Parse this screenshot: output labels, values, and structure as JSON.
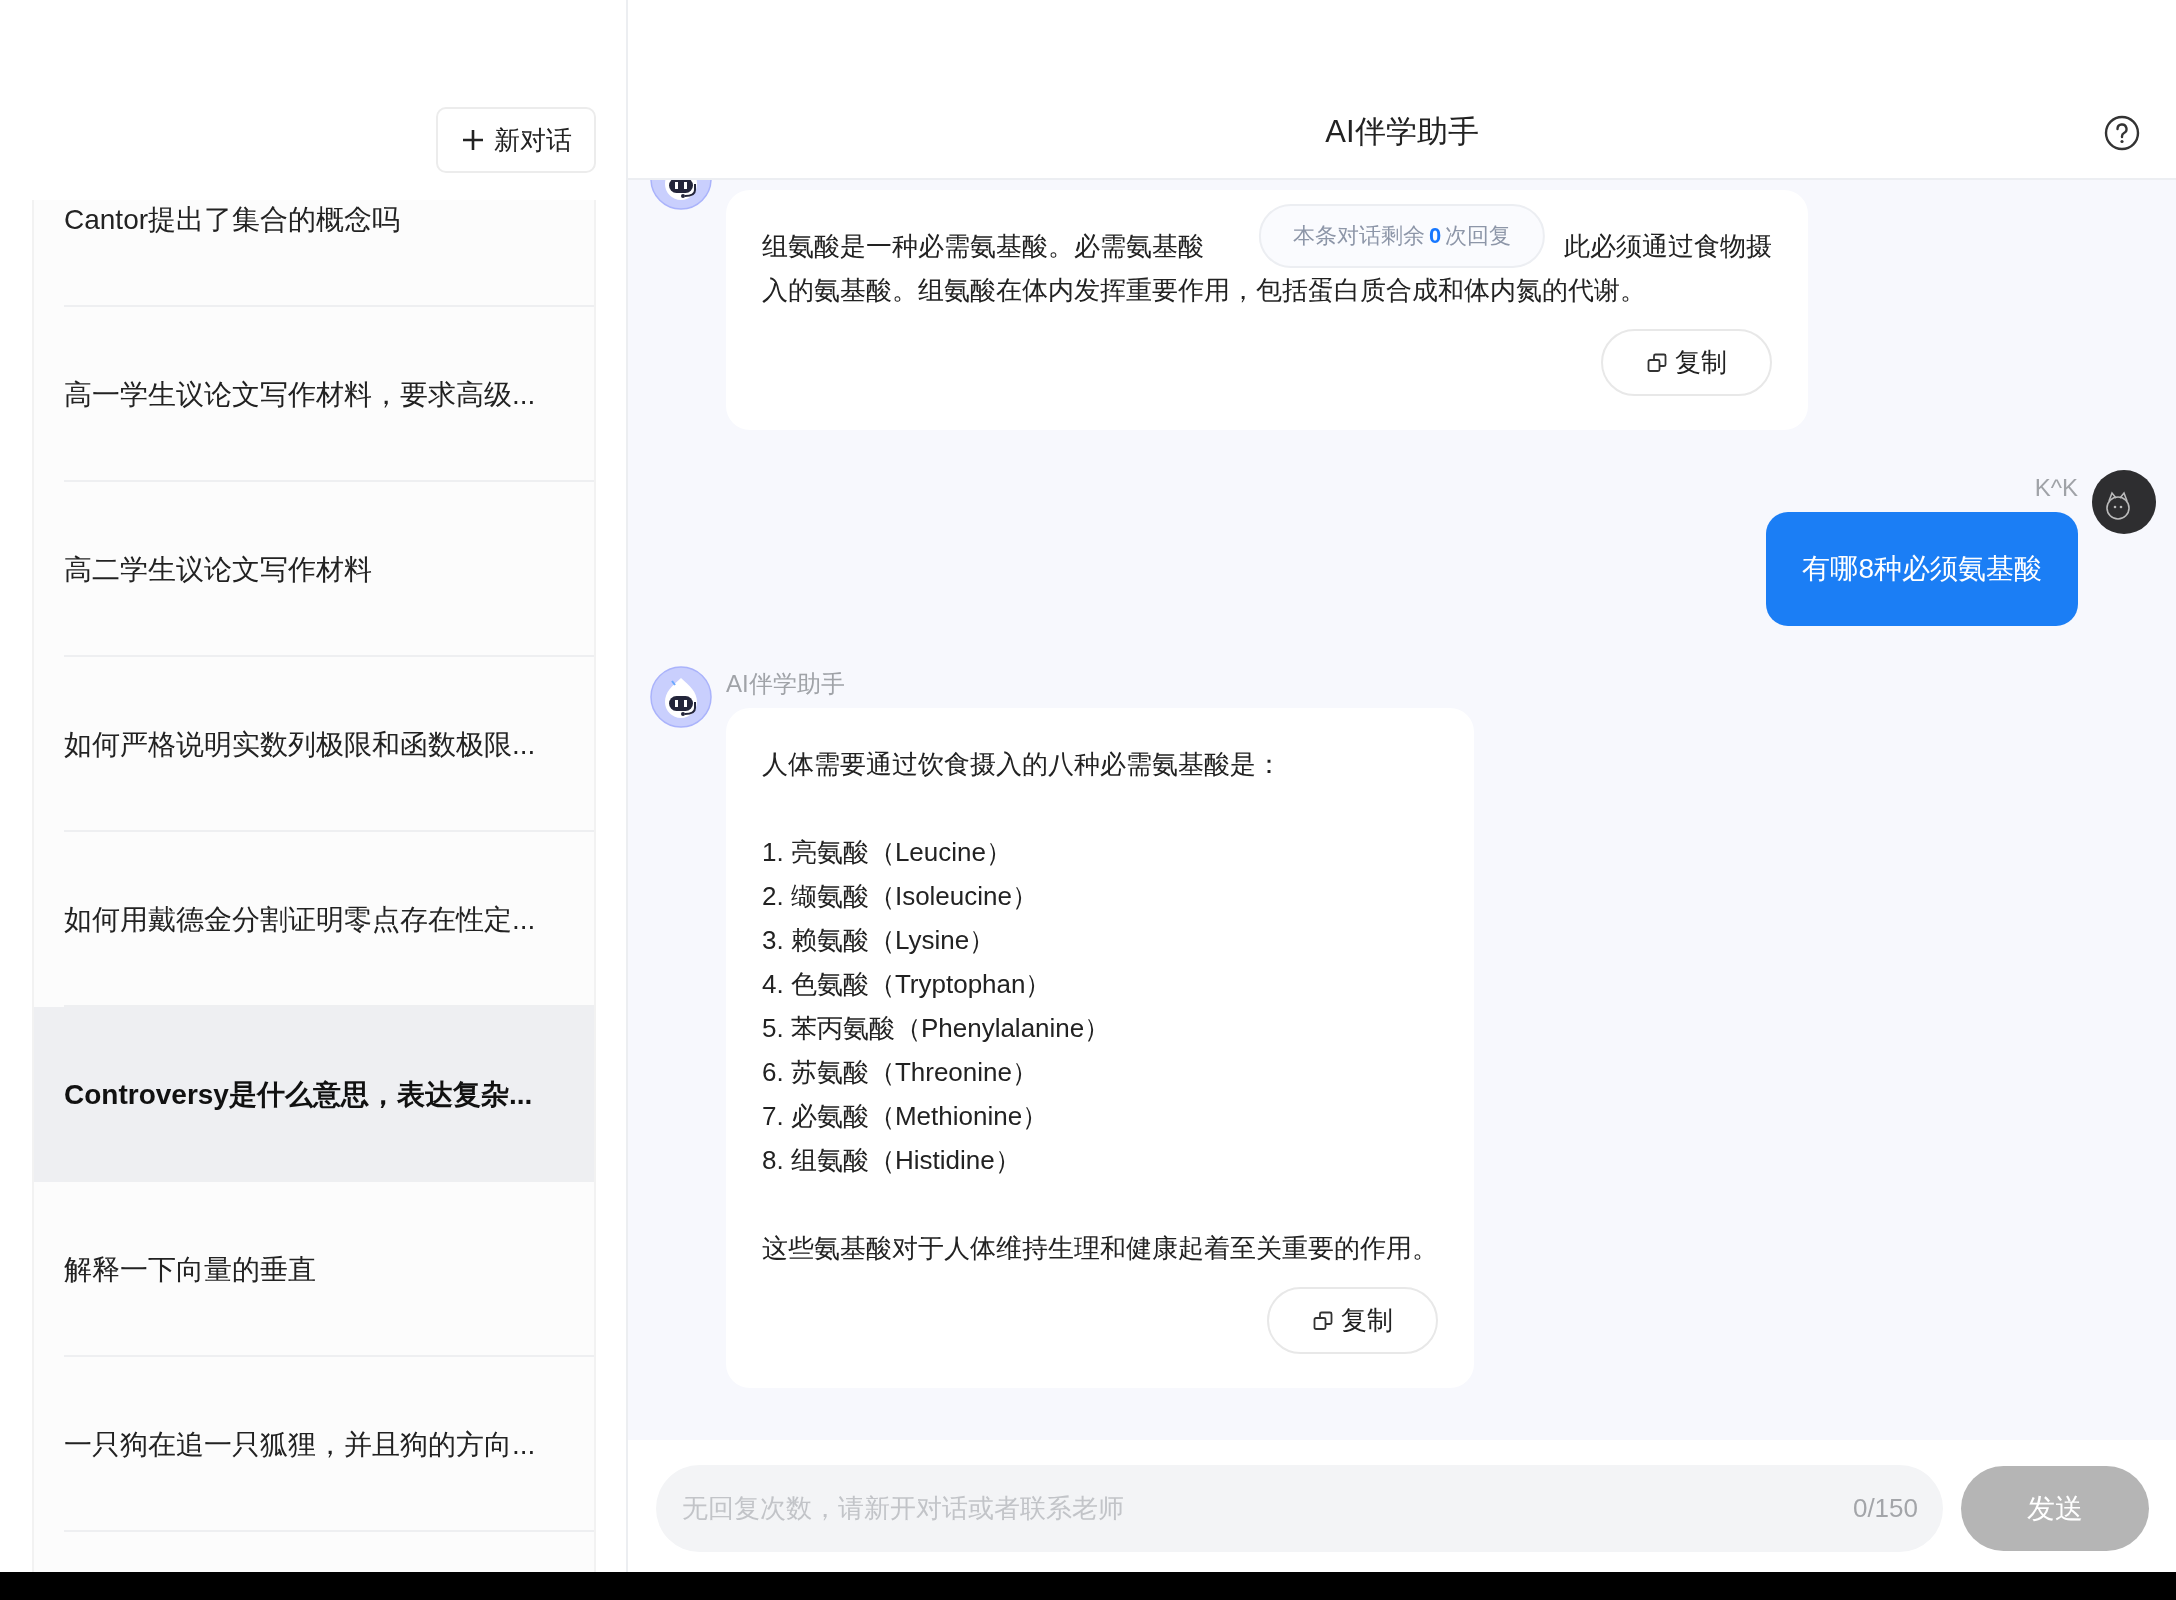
{
  "sidebar": {
    "new_chat_button": "新对话",
    "conversations": [
      {
        "title": "Cantor提出了集合的概念吗",
        "selected": false
      },
      {
        "title": "高一学生议论文写作材料，要求高级...",
        "selected": false
      },
      {
        "title": "高二学生议论文写作材料",
        "selected": false
      },
      {
        "title": "如何严格说明实数列极限和函数极限...",
        "selected": false
      },
      {
        "title": "如何用戴德金分割证明零点存在性定...",
        "selected": false
      },
      {
        "title": "Controversy是什么意思，表达复杂...",
        "selected": true
      },
      {
        "title": "解释一下向量的垂直",
        "selected": false
      },
      {
        "title": "一只狗在追一只狐狸，并且狗的方向...",
        "selected": false
      }
    ]
  },
  "chat": {
    "title": "AI伴学助手",
    "quota_notice": {
      "before": "本条对话剩余",
      "count": "0",
      "after": "次回复"
    },
    "messages": [
      {
        "kind": "bot",
        "blocks": [
          {
            "kind": "covered_lines",
            "lines": [
              [
                "组氨酸是一种必需氨基酸。必需氨基酸",
                "此必须通过食物摄"
              ],
              [
                "入的氨基酸。组氨酸在体内发挥重要作用，包括蛋白质合成和体内氮的代谢。"
              ]
            ]
          }
        ],
        "copy_label": "复制"
      },
      {
        "kind": "user",
        "sender": "K^K",
        "text": "有哪8种必须氨基酸"
      },
      {
        "kind": "bot",
        "sender": "AI伴学助手",
        "blocks": [
          {
            "kind": "paragraph",
            "text": "人体需要通过饮食摄入的八种必需氨基酸是："
          },
          {
            "kind": "list",
            "items": [
              "1. 亮氨酸（Leucine）",
              "2. 缬氨酸（Isoleucine）",
              "3. 赖氨酸（Lysine）",
              "4. 色氨酸（Tryptophan）",
              "5. 苯丙氨酸（Phenylalanine）",
              "6. 苏氨酸（Threonine）",
              "7. 必氨酸（Methionine）",
              "8. 组氨酸（Histidine）"
            ]
          },
          {
            "kind": "paragraph",
            "text": "这些氨基酸对于人体维持生理和健康起着至关重要的作用。"
          }
        ],
        "copy_label": "复制"
      }
    ],
    "input": {
      "placeholder": "无回复次数，请新开对话或者联系老师",
      "counter": "0/150",
      "disabled": true
    },
    "send_button": {
      "label": "发送",
      "disabled": true
    }
  }
}
